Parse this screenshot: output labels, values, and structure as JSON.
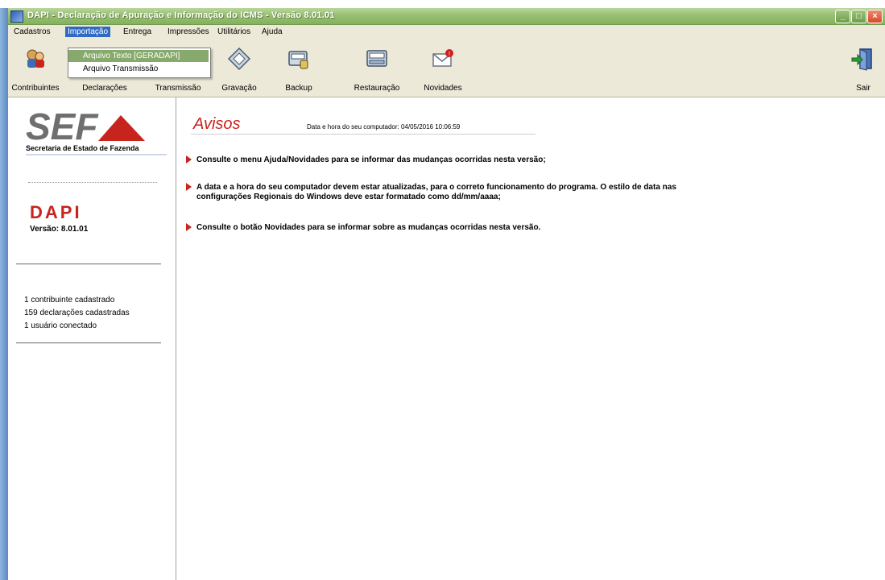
{
  "window": {
    "title": "DAPI - Declaração de Apuração e Informação do ICMS - Versão 8.01.01"
  },
  "menubar": {
    "items": [
      "Cadastros",
      "Importação",
      "Entrega",
      "Impressões",
      "Utilitários",
      "Ajuda"
    ],
    "active": "Importação"
  },
  "dropdown": {
    "items": [
      "Arquivo Texto [GERADAPI]",
      "Arquivo Transmissão"
    ],
    "highlighted": "Arquivo Texto [GERADAPI]"
  },
  "toolbar": {
    "contribuintes": "Contribuintes",
    "declaracoes": "Declarações",
    "transmissao": "Transmissão",
    "gravacao": "Gravação",
    "backup": "Backup",
    "restauracao": "Restauração",
    "novidades": "Novidades",
    "sair": "Sair"
  },
  "sidebar": {
    "logo_text": "SEF",
    "logo_subtitle": "Secretaria de Estado de Fazenda",
    "app_name": "DAPI",
    "version": "Versão: 8.01.01",
    "stats": [
      "1 contribuinte cadastrado",
      "159 declarações cadastradas",
      "1 usuário conectado"
    ]
  },
  "content": {
    "heading": "Avisos",
    "datetime": "Data e hora do seu computador: 04/05/2016 10:06:59",
    "notices": [
      "Consulte o menu Ajuda/Novidades para se informar das mudanças ocorridas nesta versão;",
      "A data e a hora do seu computador devem estar atualizadas, para o correto funcionamento do programa. O estilo de data nas",
      "configurações Regionais do Windows deve estar formatado como dd/mm/aaaa;",
      "Consulte o botão Novidades para se informar sobre as mudanças ocorridas nesta versão."
    ]
  },
  "colors": {
    "accent_red": "#c8241e",
    "title_bar_green": "#97bf72",
    "menu_highlight": "#87a96b",
    "chrome": "#ece9d8"
  }
}
